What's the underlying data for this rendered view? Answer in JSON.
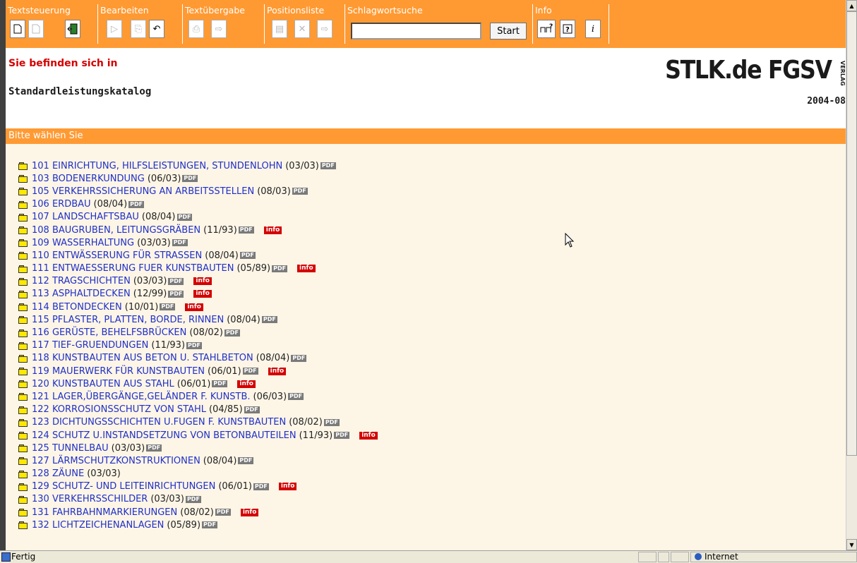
{
  "toolbar": {
    "groups": [
      {
        "title": "Textsteuerung"
      },
      {
        "title": "Bearbeiten"
      },
      {
        "title": "Textübergabe"
      },
      {
        "title": "Positionsliste"
      },
      {
        "title": "Schlagwortsuche"
      },
      {
        "title": "Info"
      }
    ],
    "search_value": "",
    "start_label": "Start",
    "accent_color": "#ff9a33"
  },
  "header": {
    "location_label": "Sie befinden sich in",
    "location_value": "Standardleistungskatalog",
    "logo_text": "STLK.de FGSV",
    "logo_sub": "VERLAG",
    "date": "2004-08"
  },
  "section": {
    "title": "Bitte wählen Sie"
  },
  "pdf_badge": "PDF",
  "info_badge": "info",
  "items": [
    {
      "label": "101 EINRICHTUNG, HILFSLEISTUNGEN, STUNDENLOHN",
      "date": "(03/03)",
      "pdf": true,
      "info": false
    },
    {
      "label": "103 BODENERKUNDUNG",
      "date": "(06/03)",
      "pdf": true,
      "info": false
    },
    {
      "label": "105 VERKEHRSSICHERUNG AN ARBEITSSTELLEN",
      "date": "(08/03)",
      "pdf": true,
      "info": false
    },
    {
      "label": "106 ERDBAU",
      "date": "(08/04)",
      "pdf": true,
      "info": false
    },
    {
      "label": "107 LANDSCHAFTSBAU",
      "date": "(08/04)",
      "pdf": true,
      "info": false
    },
    {
      "label": "108 BAUGRUBEN, LEITUNGSGRÄBEN",
      "date": "(11/93)",
      "pdf": true,
      "info": true
    },
    {
      "label": "109 WASSERHALTUNG",
      "date": "(03/03)",
      "pdf": true,
      "info": false
    },
    {
      "label": "110 ENTWÄSSERUNG FÜR STRASSEN",
      "date": "(08/04)",
      "pdf": true,
      "info": false
    },
    {
      "label": "111 ENTWAESSERUNG FUER KUNSTBAUTEN",
      "date": "(05/89)",
      "pdf": true,
      "info": true
    },
    {
      "label": "112 TRAGSCHICHTEN",
      "date": "(03/03)",
      "pdf": true,
      "info": true
    },
    {
      "label": "113 ASPHALTDECKEN",
      "date": "(12/99)",
      "pdf": true,
      "info": true
    },
    {
      "label": "114 BETONDECKEN",
      "date": "(10/01)",
      "pdf": true,
      "info": true
    },
    {
      "label": "115 PFLASTER, PLATTEN, BORDE, RINNEN",
      "date": "(08/04)",
      "pdf": true,
      "info": false
    },
    {
      "label": "116 GERÜSTE, BEHELFSBRÜCKEN",
      "date": "(08/02)",
      "pdf": true,
      "info": false
    },
    {
      "label": "117 TIEF-GRUENDUNGEN",
      "date": "(11/93)",
      "pdf": true,
      "info": false
    },
    {
      "label": "118 KUNSTBAUTEN AUS BETON U. STAHLBETON",
      "date": "(08/04)",
      "pdf": true,
      "info": false
    },
    {
      "label": "119 MAUERWERK FÜR KUNSTBAUTEN",
      "date": "(06/01)",
      "pdf": true,
      "info": true
    },
    {
      "label": "120 KUNSTBAUTEN AUS STAHL",
      "date": "(06/01)",
      "pdf": true,
      "info": true
    },
    {
      "label": "121 LAGER,ÜBERGÄNGE,GELÄNDER F. KUNSTB.",
      "date": "(06/03)",
      "pdf": true,
      "info": false
    },
    {
      "label": "122 KORROSIONSSCHUTZ VON STAHL",
      "date": "(04/85)",
      "pdf": true,
      "info": false
    },
    {
      "label": "123 DICHTUNGSSCHICHTEN U.FUGEN F. KUNSTBAUTEN",
      "date": "(08/02)",
      "pdf": true,
      "info": false
    },
    {
      "label": "124 SCHUTZ U.INSTANDSETZUNG VON BETONBAUTEILEN",
      "date": "(11/93)",
      "pdf": true,
      "info": true
    },
    {
      "label": "125 TUNNELBAU",
      "date": "(03/03)",
      "pdf": true,
      "info": false
    },
    {
      "label": "127 LÄRMSCHUTZKONSTRUKTIONEN",
      "date": "(08/04)",
      "pdf": true,
      "info": false
    },
    {
      "label": "128 ZÄUNE",
      "date": "(03/03)",
      "pdf": false,
      "info": false
    },
    {
      "label": "129 SCHUTZ- UND LEITEINRICHTUNGEN",
      "date": "(06/01)",
      "pdf": true,
      "info": true
    },
    {
      "label": "130 VERKEHRSSCHILDER",
      "date": "(03/03)",
      "pdf": true,
      "info": false
    },
    {
      "label": "131 FAHRBAHNMARKIERUNGEN",
      "date": "(08/02)",
      "pdf": true,
      "info": true
    },
    {
      "label": "132 LICHTZEICHENANLAGEN",
      "date": "(05/89)",
      "pdf": true,
      "info": false
    }
  ],
  "status": {
    "text": "Fertig",
    "zone": "Internet"
  }
}
